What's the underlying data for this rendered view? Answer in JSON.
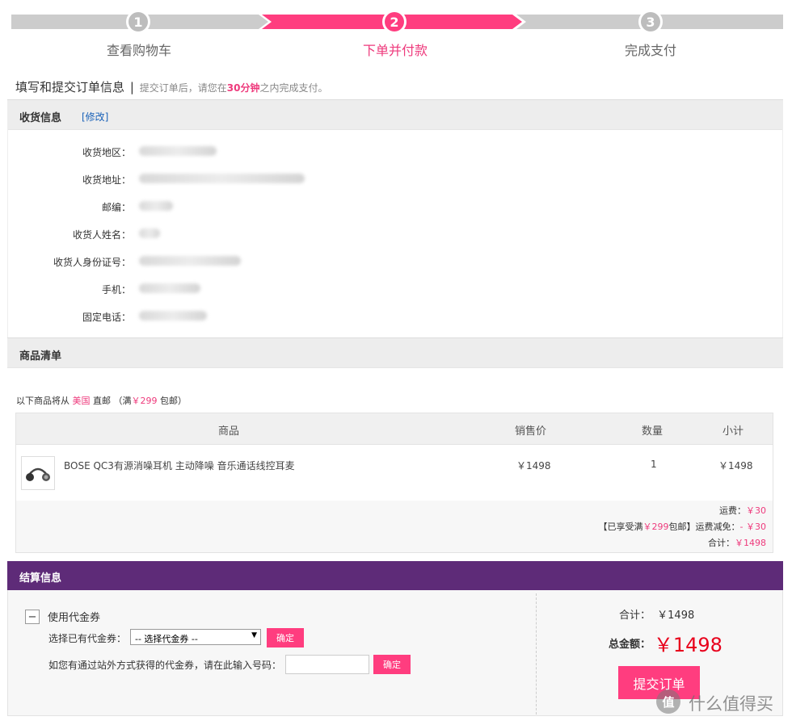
{
  "steps": [
    {
      "num": "1",
      "label": "查看购物车"
    },
    {
      "num": "2",
      "label": "下单并付款"
    },
    {
      "num": "3",
      "label": "完成支付"
    }
  ],
  "header": {
    "title": "填写和提交订单信息",
    "separator": "|",
    "note_prefix": "提交订单后，请您在",
    "note_highlight": "30分钟",
    "note_suffix": "之内完成支付。"
  },
  "shipping": {
    "title": "收货信息",
    "edit_link": "[修改]",
    "fields": [
      "收货地区：",
      "收货地址：",
      "邮编：",
      "收货人姓名：",
      "收货人身份证号：",
      "手机：",
      "固定电话："
    ]
  },
  "products": {
    "title": "商品清单",
    "origin_prefix": "以下商品将从",
    "origin_country": "美国",
    "origin_method": "直邮",
    "free_ship_prefix": "（满",
    "free_ship_amount": "￥299",
    "free_ship_suffix": "包邮）",
    "columns": [
      "商品",
      "销售价",
      "数量",
      "小计"
    ],
    "rows": [
      {
        "name": "BOSE QC3有源消噪耳机 主动降噪 音乐通话线控耳麦",
        "price": "￥1498",
        "qty": "1",
        "subtotal": "￥1498"
      }
    ],
    "shipping_fee_label": "运费：",
    "shipping_fee": "￥30",
    "discount_prefix": "【已享受满",
    "discount_amount": "￥299",
    "discount_suffix": "包邮】运费减免：",
    "discount_value": "- ￥30",
    "total_label": "合计：",
    "total_value": "￥1498"
  },
  "checkout": {
    "title": "结算信息",
    "coupon_toggle": "−",
    "coupon_title": "使用代金券",
    "select_label": "选择已有代金券：",
    "select_value": "-- 选择代金券 --",
    "confirm_label": "确定",
    "external_label": "如您有通过站外方式获得的代金券，请在此输入号码：",
    "external_placeholder": "",
    "confirm_label2": "确定",
    "sum_label": "合计：",
    "sum_value": "￥1498",
    "grand_label": "总金额：",
    "grand_value": "￥1498",
    "submit_label": "提交订单"
  },
  "watermark": {
    "text": "什么值得买",
    "glyph": "值"
  }
}
